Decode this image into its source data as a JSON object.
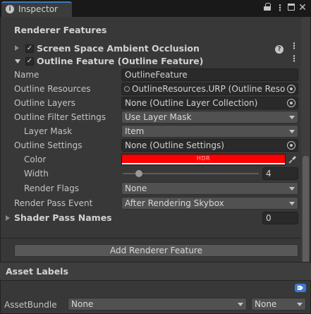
{
  "window": {
    "tab_label": "Inspector",
    "tab_icon": "info-icon",
    "actions": [
      "lock-icon",
      "kebab-menu-icon",
      "maximize-icon",
      "close-icon"
    ]
  },
  "renderer_features": {
    "header": "Renderer Features",
    "ssao": {
      "label": "Screen Space Ambient Occlusion",
      "enabled": true,
      "expanded": false
    },
    "outline": {
      "label": "Outline Feature (Outline Feature)",
      "enabled": true,
      "expanded": true
    }
  },
  "properties": {
    "name": {
      "label": "Name",
      "value": "OutlineFeature"
    },
    "outline_resources": {
      "label": "Outline Resources",
      "value": "OutlineResources.URP (Outline Resour"
    },
    "outline_layers": {
      "label": "Outline Layers",
      "value": "None (Outline Layer Collection)"
    },
    "outline_filter_settings": {
      "label": "Outline Filter Settings",
      "value": "Use Layer Mask"
    },
    "layer_mask": {
      "label": "Layer Mask",
      "value": "Item"
    },
    "outline_settings": {
      "label": "Outline Settings",
      "value": "None (Outline Settings)"
    },
    "color": {
      "label": "Color",
      "hdr_text": "HDR",
      "value": "#ff0000"
    },
    "width": {
      "label": "Width",
      "value": "4",
      "slider_fraction": 0.12
    },
    "render_flags": {
      "label": "Render Flags",
      "value": "None"
    },
    "render_pass_event": {
      "label": "Render Pass Event",
      "value": "After Rendering Skybox"
    },
    "shader_pass_names": {
      "label": "Shader Pass Names",
      "value": "0"
    }
  },
  "add_renderer_feature": "Add Renderer Feature",
  "asset_labels": {
    "header": "Asset Labels",
    "asset_bundle_label": "AssetBundle",
    "bundle_value": "None",
    "variant_value": "None"
  },
  "colors": {
    "background": "#383838",
    "tab_accent": "#3a79bb",
    "field_bg": "#2a2a2a",
    "dropdown_bg": "#515151",
    "hdr_color": "#ff0000",
    "tag_icon": "#3a7bd5"
  }
}
